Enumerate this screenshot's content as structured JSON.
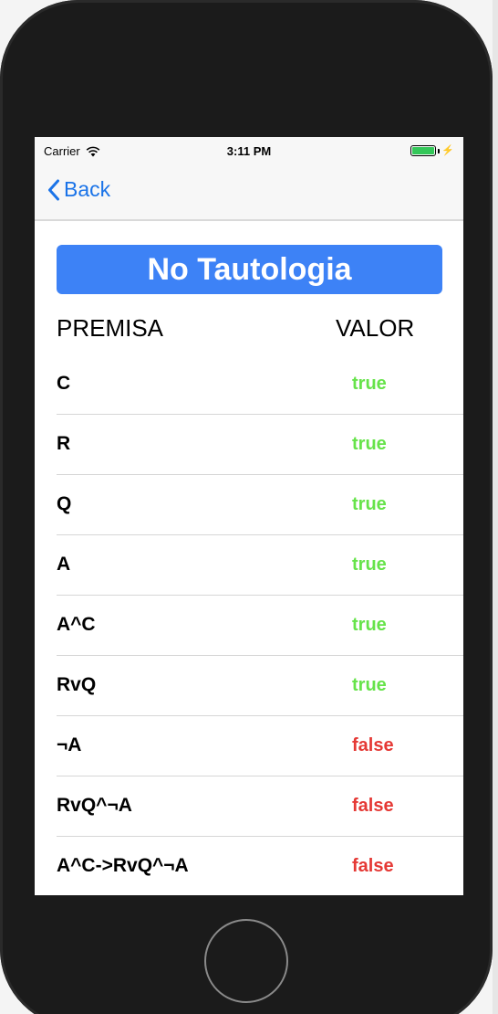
{
  "status_bar": {
    "carrier": "Carrier",
    "time": "3:11 PM",
    "battery_level": 1.0
  },
  "nav": {
    "back_label": "Back"
  },
  "result": {
    "label": "No Tautologia"
  },
  "table": {
    "headers": {
      "premise": "PREMISA",
      "value": "VALOR"
    },
    "rows": [
      {
        "premise": "C",
        "value": "true"
      },
      {
        "premise": "R",
        "value": "true"
      },
      {
        "premise": "Q",
        "value": "true"
      },
      {
        "premise": "A",
        "value": "true"
      },
      {
        "premise": "A^C",
        "value": "true"
      },
      {
        "premise": "RvQ",
        "value": "true"
      },
      {
        "premise": "¬A",
        "value": "false"
      },
      {
        "premise": "RvQ^¬A",
        "value": "false"
      },
      {
        "premise": "A^C->RvQ^¬A",
        "value": "false"
      }
    ]
  },
  "colors": {
    "accent": "#3d82f6",
    "link": "#1a73e8",
    "true": "#66e34a",
    "false": "#e53935"
  },
  "icons": {
    "wifi": "wifi-icon",
    "back": "chevron-left-icon",
    "battery": "battery-icon",
    "charging": "bolt-icon"
  }
}
